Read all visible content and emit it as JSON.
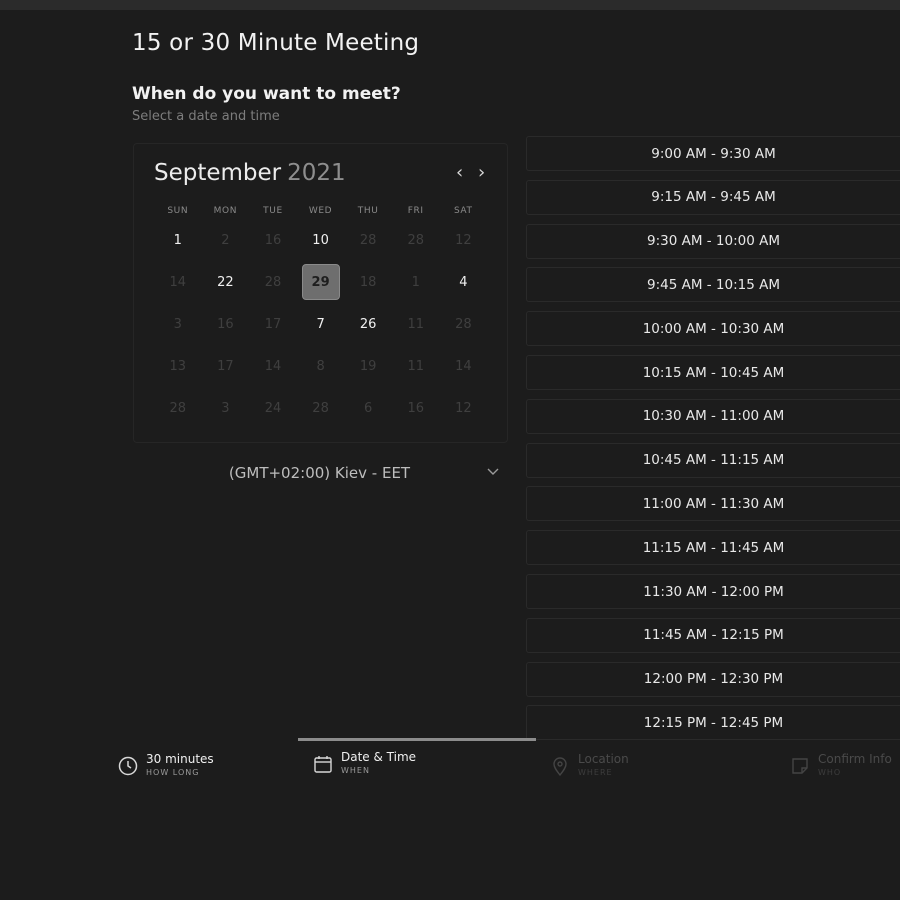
{
  "page": {
    "title": "15 or 30 Minute Meeting",
    "question": "When do you want to meet?",
    "subtitle": "Select a date and time"
  },
  "calendar": {
    "month": "September",
    "year": "2021",
    "prev_icon": "chevron-left-icon",
    "next_icon": "chevron-right-icon",
    "weekdays": [
      "SUN",
      "MON",
      "TUE",
      "WED",
      "THU",
      "FRI",
      "SAT"
    ],
    "weeks": [
      [
        {
          "d": "1",
          "a": true
        },
        {
          "d": "2",
          "a": false
        },
        {
          "d": "16",
          "a": false
        },
        {
          "d": "10",
          "a": true
        },
        {
          "d": "28",
          "a": false
        },
        {
          "d": "28",
          "a": false
        },
        {
          "d": "12",
          "a": false
        }
      ],
      [
        {
          "d": "14",
          "a": false
        },
        {
          "d": "22",
          "a": true
        },
        {
          "d": "28",
          "a": false
        },
        {
          "d": "29",
          "a": true,
          "s": true
        },
        {
          "d": "18",
          "a": false
        },
        {
          "d": "1",
          "a": false
        },
        {
          "d": "4",
          "a": true
        }
      ],
      [
        {
          "d": "3",
          "a": false
        },
        {
          "d": "16",
          "a": false
        },
        {
          "d": "17",
          "a": false
        },
        {
          "d": "7",
          "a": true
        },
        {
          "d": "26",
          "a": true
        },
        {
          "d": "11",
          "a": false
        },
        {
          "d": "28",
          "a": false
        }
      ],
      [
        {
          "d": "13",
          "a": false
        },
        {
          "d": "17",
          "a": false
        },
        {
          "d": "14",
          "a": false
        },
        {
          "d": "8",
          "a": false
        },
        {
          "d": "19",
          "a": false
        },
        {
          "d": "11",
          "a": false
        },
        {
          "d": "14",
          "a": false
        }
      ],
      [
        {
          "d": "28",
          "a": false
        },
        {
          "d": "3",
          "a": false
        },
        {
          "d": "24",
          "a": false
        },
        {
          "d": "28",
          "a": false
        },
        {
          "d": "6",
          "a": false
        },
        {
          "d": "16",
          "a": false
        },
        {
          "d": "12",
          "a": false
        }
      ]
    ],
    "selected_day": "29"
  },
  "timezone": {
    "label": "(GMT+02:00) Kiev - EET",
    "icon": "chevron-down-icon"
  },
  "slots": [
    "9:00 AM - 9:30 AM",
    "9:15 AM - 9:45 AM",
    "9:30 AM - 10:00 AM",
    "9:45 AM - 10:15 AM",
    "10:00 AM - 10:30 AM",
    "10:15 AM - 10:45 AM",
    "10:30 AM - 11:00 AM",
    "10:45 AM - 11:15 AM",
    "11:00 AM - 11:30 AM",
    "11:15 AM - 11:45 AM",
    "11:30 AM - 12:00 PM",
    "11:45 AM - 12:15 PM",
    "12:00 PM - 12:30 PM",
    "12:15 PM - 12:45 PM"
  ],
  "steps": [
    {
      "title": "30 minutes",
      "sub": "HOW LONG",
      "icon": "clock-icon"
    },
    {
      "title": "Date & Time",
      "sub": "WHEN",
      "icon": "calendar-icon"
    },
    {
      "title": "Location",
      "sub": "WHERE",
      "icon": "location-pin-icon"
    },
    {
      "title": "Confirm Info",
      "sub": "WHO",
      "icon": "note-icon"
    }
  ],
  "colors": {
    "background": "#1c1c1c",
    "selected_day": "#6e6e6e",
    "progress": "#8c8c8c"
  }
}
